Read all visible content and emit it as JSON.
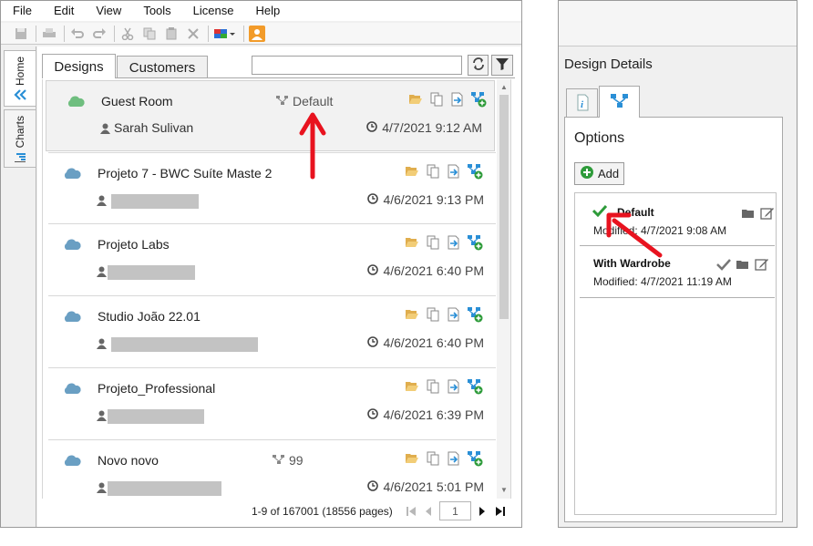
{
  "menu": [
    "File",
    "Edit",
    "View",
    "Tools",
    "License",
    "Help"
  ],
  "side_tabs": [
    {
      "label": "Home",
      "icon": "chevrons-double-icon"
    },
    {
      "label": "Charts",
      "icon": "bar-chart-icon"
    }
  ],
  "tabs": {
    "designs": "Designs",
    "customers": "Customers"
  },
  "search": {
    "placeholder": ""
  },
  "designs": [
    {
      "name": "Guest Room",
      "user": "Sarah Sulivan",
      "variant": "Default",
      "date": "4/7/2021 9:12 AM",
      "cloud_color": "#6fbe7f",
      "selected": true
    },
    {
      "name": "Projeto 7 - BWC Suíte Maste 2",
      "user": "",
      "variant": "",
      "date": "4/6/2021 9:13 PM",
      "cloud_color": "#6a9fc3",
      "selected": false
    },
    {
      "name": "Projeto Labs",
      "user": "",
      "variant": "",
      "date": "4/6/2021 6:40 PM",
      "cloud_color": "#6a9fc3",
      "selected": false
    },
    {
      "name": "Studio João 22.01",
      "user": "",
      "variant": "",
      "date": "4/6/2021 6:40 PM",
      "cloud_color": "#6a9fc3",
      "selected": false
    },
    {
      "name": "Projeto_Professional",
      "user": "",
      "variant": "",
      "date": "4/6/2021 6:39 PM",
      "cloud_color": "#6a9fc3",
      "selected": false
    },
    {
      "name": "Novo novo",
      "user": "",
      "variant": "99",
      "date": "4/6/2021 5:01 PM",
      "cloud_color": "#6a9fc3",
      "selected": false
    }
  ],
  "pager": {
    "text": "1-9 of 167001 (18556 pages)",
    "page": "1"
  },
  "details": {
    "title": "Design Details",
    "options_title": "Options",
    "add_label": "Add",
    "options": [
      {
        "name": "Default",
        "modified": "Modified: 4/7/2021 9:08 AM",
        "active": true
      },
      {
        "name": "With Wardrobe",
        "modified": "Modified: 4/7/2021 11:19 AM",
        "active": false
      }
    ]
  },
  "colors": {
    "accent_blue": "#2a8fd6",
    "arrow_red": "#e8131f",
    "check_green": "#2e9b3a",
    "folder_yellow": "#e8c062"
  }
}
